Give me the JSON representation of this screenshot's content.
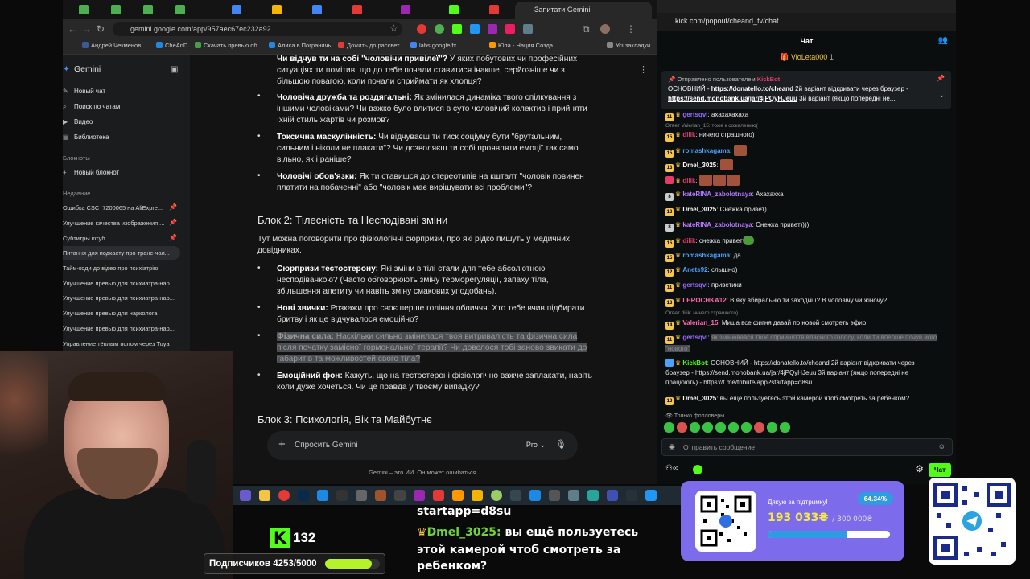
{
  "browser": {
    "tab_title": "Запитати Gemini",
    "url": "gemini.google.com/app/957aec67ec232a92",
    "bookmarks": [
      {
        "label": "Андрей Чекменов..",
        "color": "#3b5998"
      },
      {
        "label": "CheAnD",
        "color": "#1e88e5"
      },
      {
        "label": "Скачать превью об...",
        "color": "#43a047"
      },
      {
        "label": "Алиса в Пограничь...",
        "color": "#1e88e5"
      },
      {
        "label": "Дожить до рассвет...",
        "color": "#e53935"
      },
      {
        "label": "labs.google/fx",
        "color": "#4285f4"
      },
      {
        "label": "Юла - Нация Созда...",
        "color": "#ff9800"
      },
      {
        "label": "Усі закладки",
        "color": "#888888"
      }
    ]
  },
  "gemini_sidebar": {
    "app_name": "Gemini",
    "nav": [
      {
        "icon": "new-chat-icon",
        "label": "Новый чат"
      },
      {
        "icon": "search-icon",
        "label": "Поиск по чатам"
      },
      {
        "icon": "video-icon",
        "label": "Видео"
      },
      {
        "icon": "library-icon",
        "label": "Библиотека"
      }
    ],
    "notebooks_label": "Блокноты",
    "new_notebook": "Новый блокнот",
    "recent_label": "Недавние",
    "recent": [
      {
        "label": "Ошибка CSC_7200065 на AliExpre...",
        "pinned": true
      },
      {
        "label": "Улучшение качества изображения ...",
        "pinned": true
      },
      {
        "label": "Субтитры ютуб",
        "pinned": true
      },
      {
        "label": "Питання для подкасту про транс-чол...",
        "pinned": false
      },
      {
        "label": "Тайм-коди до відео про психіатрію",
        "pinned": false
      },
      {
        "label": "Улучшение превью для психиатра-нар...",
        "pinned": false
      },
      {
        "label": "Улучшение превью для психиатра-нар...",
        "pinned": false
      },
      {
        "label": "Улучшение превью для нарколога",
        "pinned": false
      },
      {
        "label": "Улучшение превью для психиатра-нар...",
        "pinned": false
      },
      {
        "label": "Управление тёплым полом через Tuya",
        "pinned": false
      }
    ]
  },
  "gemini_content": {
    "top_item": {
      "title": "Чи відчув ти на собі \"чоловічи привілеї\"?",
      "text": " У яких побутових чи професійних ситуаціях ти помітив, що до тебе почали ставитися інакше, серйозніше чи з більшою повагою, коли почали сприймати як хлопця?"
    },
    "block1_items": [
      {
        "title": "Чоловіча дружба та роздягальні:",
        "text": " Як змінилася динаміка твого спілкування з іншими чоловіками? Чи важко було влитися в суто чоловічий колектив і прийняти їхній стиль жартів чи розмов?"
      },
      {
        "title": "Токсична маскулінність:",
        "text": " Чи відчуваєш ти тиск соціуму бути \"брутальним, сильним і ніколи не плакати\"? Чи дозволяєш ти собі проявляти емоції так само вільно, як і раніше?"
      },
      {
        "title": "Чоловічі обов'язки:",
        "text": " Як ти ставишся до стереотипів на кшталт \"чоловік повинен платити на побаченні\" або \"чоловік має вирішувати всі проблеми\"?"
      }
    ],
    "block2_heading": "Блок 2: Тілесність та Несподівані зміни",
    "block2_intro": "Тут можна поговорити про фізіологічні сюрпризи, про які рідко пишуть у медичних довідниках.",
    "block2_items": [
      {
        "title": "Сюрпризи тестостерону:",
        "text": " Які зміни в тілі стали для тебе абсолютною несподіванкою? (Часто обговорюють зміну терморегуляції, запаху тіла, збільшення апетиту чи навіть зміну смакових уподобань)."
      },
      {
        "title": "Нові звички:",
        "text": " Розкажи про своє перше гоління обличчя. Хто тебе вчив підбирати бритву і як це відчувалося емоційно?"
      },
      {
        "title": "Фізична сила:",
        "text": " Наскільки сильно змінилася твоя витривалість та фізична сила після початку замісної гормональної терапії? Чи довелося тобі заново звикати до габаритів та можливостей свого тіла?"
      },
      {
        "title": "Емоційний фон:",
        "text": " Кажуть, що на тестостероні фізіологічно важче заплакати, навіть коли дуже хочеться. Чи це правда у твоєму випадку?"
      }
    ],
    "block3_heading": "Блок 3: Психологія, Вік та Майбутнє",
    "prompt_placeholder": "Спросить Gemini",
    "model": "Pro",
    "disclaimer": "Gemini – это ИИ. Он может ошибаться."
  },
  "kick_chat": {
    "url": "kick.com/popout/cheand_tv/chat",
    "header": "Чат",
    "top_gifter": "VioLeta000",
    "top_gifter_count": "1",
    "pinned_by_label": "Отправлено пользователем",
    "pinned_user": "KickBot",
    "pinned_text_1": "ОСНОВНИЙ - ",
    "pinned_link_1": "https://donatello.to/cheand",
    "pinned_text_2": " 2й варіант відкривати через браузер - ",
    "pinned_link_2": "https://send.monobank.ua/jar/4jPQyHJeuu",
    "pinned_text_3": " 3й варіант (якщо попередні не...",
    "messages": [
      {
        "badge": "11",
        "badge_color": "#f5c64a",
        "user": "gertsqvi",
        "color": "#9b6bff",
        "text": "ахахахахаха"
      },
      {
        "reply": "Ответ Valerian_15: тоже к сожалению("
      },
      {
        "badge": "15",
        "badge_color": "#f5c64a",
        "user": "dilik",
        "color": "#e53a6a",
        "text": "ничего страшного)"
      },
      {
        "badge": "15",
        "badge_color": "#f5c64a",
        "user": "romashkagama",
        "color": "#4aa3ff",
        "text": "",
        "emotes": 1
      },
      {
        "badge": "13",
        "badge_color": "#f5c64a",
        "user": "Dmel_3025",
        "color": "#ffffff",
        "text": "",
        "emotes": 1
      },
      {
        "badge": "",
        "badge_color": "#e53a6a",
        "user": "dilik",
        "color": "#e53a6a",
        "text": "",
        "emotes": 3
      },
      {
        "badge": "8",
        "badge_color": "#cccccc",
        "user": "kateRINA_zabolotnaya",
        "color": "#b77bff",
        "text": "Ахахахха"
      },
      {
        "badge": "13",
        "badge_color": "#f5c64a",
        "user": "Dmel_3025",
        "color": "#ffffff",
        "text": "Снежка привет)"
      },
      {
        "badge": "8",
        "badge_color": "#cccccc",
        "user": "kateRINA_zabolotnaya",
        "color": "#b77bff",
        "text": "Снежка привет))))"
      },
      {
        "badge": "15",
        "badge_color": "#f5c64a",
        "user": "dilik",
        "color": "#e53a6a",
        "text": "снежка привет",
        "pepe": true
      },
      {
        "badge": "15",
        "badge_color": "#f5c64a",
        "user": "romashkagama",
        "color": "#4aa3ff",
        "text": "да"
      },
      {
        "badge": "12",
        "badge_color": "#f5c64a",
        "user": "Anets92",
        "color": "#4aa3ff",
        "text": "слышно)"
      },
      {
        "badge": "11",
        "badge_color": "#f5c64a",
        "user": "gertsqvi",
        "color": "#9b6bff",
        "text": "приветики"
      },
      {
        "badge": "13",
        "badge_color": "#f5c64a",
        "user": "LEROCHKA12",
        "color": "#ff6ab1",
        "text": "В яку вбиральню ти заходиш? В чоловічу чи жіночу?"
      },
      {
        "reply": "Ответ dilik: ничего страшного)"
      },
      {
        "badge": "14",
        "badge_color": "#f5c64a",
        "user": "Valerian_15",
        "color": "#ff6ab1",
        "text": "Миша все фигня давай по новой смотреть эфир"
      },
      {
        "badge": "11",
        "badge_color": "#f5c64a",
        "user": "gertsqvi",
        "color": "#9b6bff",
        "text": "як змінювався твоє сприйняття власного голосу, коли ти вперше почув його \"нового\"",
        "highlight": true
      },
      {
        "badge": "",
        "badge_color": "#4aa3ff",
        "user": "KickBot",
        "color": "#53fc18",
        "text": "ОСНОВНИЙ - https://donatello.to/cheand 2й варіант відкривати через браузер - https://send.monobank.ua/jar/4jPQyHJeuu 3й варіант (якщо попередні не працюють) - https://t.me/tribute/app?startapp=d8su",
        "multiline": true
      },
      {
        "badge": "13",
        "badge_color": "#f5c64a",
        "user": "Dmel_3025",
        "color": "#ffffff",
        "text": "вы ещё пользуетесь этой камерой чтоб смотреть за ребенком?"
      }
    ],
    "followers_only": "Только фолловеры",
    "send_placeholder": "Отправить сообщение",
    "chat_button": "Чат"
  },
  "overlays": {
    "kick_viewers": "132",
    "subs_label": "Подписчиков 4253/5000",
    "subs_progress": 0.8506,
    "chat_lines": {
      "line0": "startapp=d8su",
      "user": "Dmel_3025:",
      "line1_rest": " вы ещё пользуетесь",
      "line2": "этой камерой чтоб смотреть за",
      "line3": "ребенком?"
    },
    "donation": {
      "thanks": "Дякую за підтримку!",
      "percent": "64.34%",
      "amount": "193 033₴",
      "goal": "/ 300 000₴",
      "progress": 0.6434
    }
  }
}
